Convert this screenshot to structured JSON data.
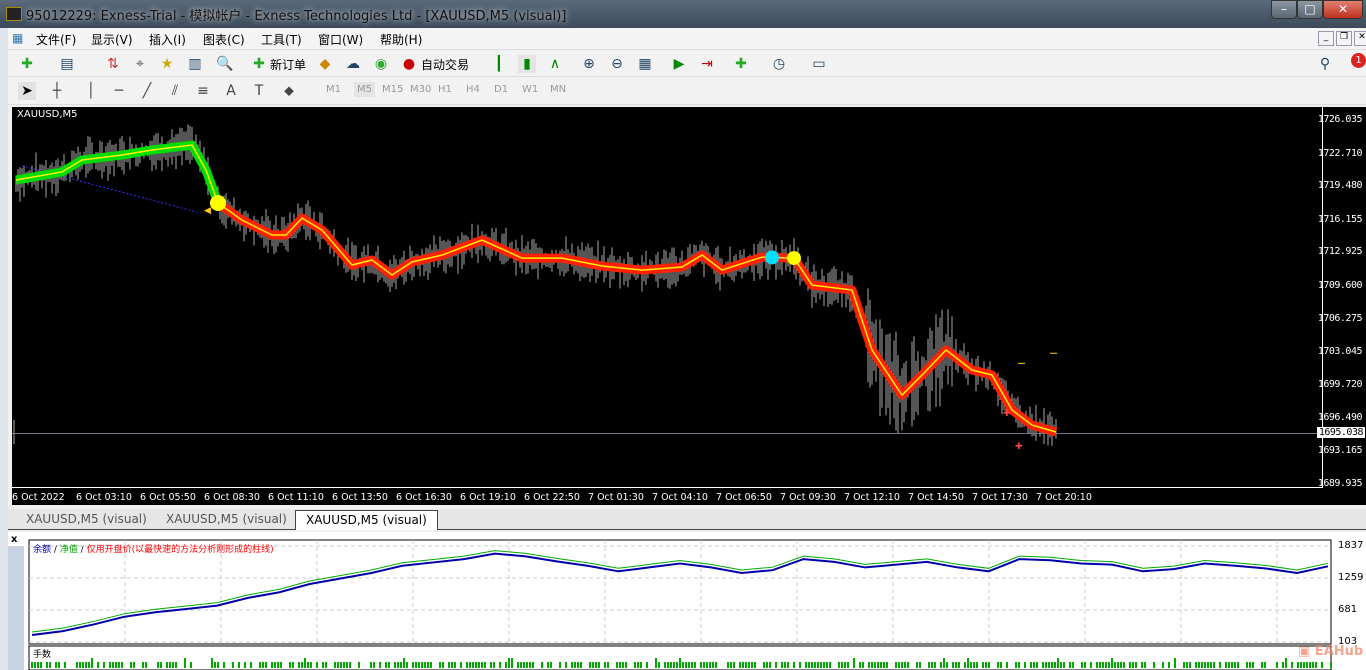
{
  "window": {
    "title": "95012229: Exness-Trial - 模拟帐户 - Exness Technologies Ltd - [XAUUSD,M5 (visual)]"
  },
  "menu": [
    "文件(F)",
    "显示(V)",
    "插入(I)",
    "图表(C)",
    "工具(T)",
    "窗口(W)",
    "帮助(H)"
  ],
  "toolbar": {
    "new_order": "新订单",
    "auto_trading": "自动交易",
    "alert_count": "1"
  },
  "timeframes": [
    "M1",
    "M5",
    "M15",
    "M30",
    "H1",
    "H4",
    "D1",
    "W1",
    "MN"
  ],
  "active_timeframe": "M5",
  "chart": {
    "symbol_label": "XAUUSD,M5",
    "current_price": "1695.038",
    "price_labels": [
      "1726.035",
      "1722.710",
      "1719.480",
      "1716.155",
      "1712.925",
      "1709.600",
      "1706.275",
      "1703.045",
      "1699.720",
      "1696.490",
      "1693.165",
      "1689.935"
    ],
    "time_labels": [
      "6 Oct 2022",
      "6 Oct 03:10",
      "6 Oct 05:50",
      "6 Oct 08:30",
      "6 Oct 11:10",
      "6 Oct 13:50",
      "6 Oct 16:30",
      "6 Oct 19:10",
      "6 Oct 22:50",
      "7 Oct 01:30",
      "7 Oct 04:10",
      "7 Oct 06:50",
      "7 Oct 09:30",
      "7 Oct 12:10",
      "7 Oct 14:50",
      "7 Oct 17:30",
      "7 Oct 20:10"
    ],
    "colors": {
      "up_trend": "#00dd00",
      "down_trend": "#ff2000",
      "line_core": "#ffee00",
      "signal_up": "#00e0ff",
      "signal_down": "#ffff00"
    },
    "trend_line_bars": [
      1,
      24,
      34,
      54,
      69,
      89,
      96,
      102,
      114,
      129,
      136,
      144,
      154,
      169,
      179,
      189,
      199,
      214,
      234,
      254,
      274,
      294,
      314,
      334,
      344,
      354,
      374,
      390,
      399,
      419,
      429,
      444,
      454,
      466,
      479,
      489,
      499,
      509,
      521
    ],
    "trend_line_prices": [
      1720.18,
      1720.98,
      1722.17,
      1722.66,
      1723.16,
      1723.65,
      1721.17,
      1717.9,
      1716.21,
      1714.73,
      1714.73,
      1716.41,
      1715.22,
      1711.75,
      1712.25,
      1710.76,
      1712.05,
      1712.74,
      1714.23,
      1712.44,
      1712.44,
      1711.65,
      1711.25,
      1711.55,
      1712.74,
      1711.25,
      1712.54,
      1712.44,
      1709.76,
      1709.27,
      1703.32,
      1698.85,
      1700.84,
      1703.32,
      1701.34,
      1700.84,
      1697.37,
      1695.88,
      1695.19
    ],
    "trend_switch_bar": 102
  },
  "tabs": [
    "XAUUSD,M5 (visual)",
    "XAUUSD,M5 (visual)",
    "XAUUSD,M5 (visual)"
  ],
  "active_tab": 2,
  "tester_graph": {
    "legend": {
      "balance": "余额",
      "equity": "净值",
      "note": "仅用开盘价(以最快速的方法分析刚形成的柱线)"
    },
    "y_labels": [
      "1837",
      "1259",
      "681",
      "103"
    ],
    "ylim": [
      103,
      1837
    ],
    "balance": [
      230,
      300,
      420,
      560,
      640,
      700,
      760,
      900,
      1000,
      1150,
      1250,
      1350,
      1480,
      1540,
      1600,
      1700,
      1650,
      1560,
      1480,
      1380,
      1450,
      1520,
      1450,
      1350,
      1400,
      1600,
      1550,
      1450,
      1500,
      1550,
      1450,
      1380,
      1600,
      1580,
      1520,
      1500,
      1380,
      1420,
      1520,
      1480,
      1430,
      1350,
      1470
    ],
    "volume_label": "手数",
    "colors": {
      "balance": "#0000aa",
      "equity": "#00aa00",
      "note": "#ff0000"
    }
  },
  "watermark": "EAHub"
}
